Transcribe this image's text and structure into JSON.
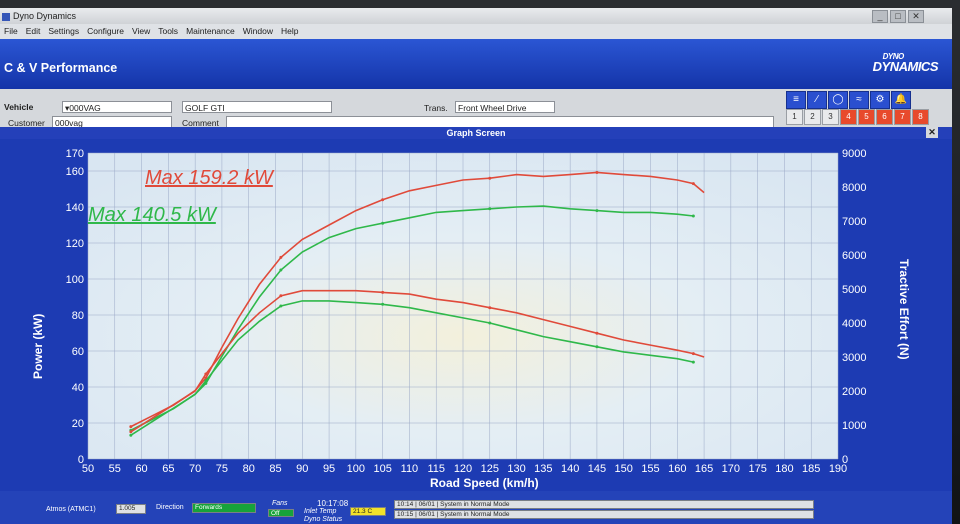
{
  "window": {
    "title": "Dyno Dynamics",
    "buttons": [
      "_",
      "□",
      "✕"
    ]
  },
  "menu": [
    "File",
    "Edit",
    "Settings",
    "Configure",
    "View",
    "Tools",
    "Maintenance",
    "Window",
    "Help"
  ],
  "header": {
    "app_name": "C & V Performance",
    "logo_top": "DYNO",
    "logo_main": "DYNAMICS"
  },
  "info": {
    "vehicle_label": "Vehicle",
    "vehicle_value": "000VAG",
    "model_value": "GOLF GTI",
    "trans_label": "Trans.",
    "trans_value": "Front Wheel Drive",
    "customer_label": "Customer",
    "customer_value": "000vag",
    "comment_label": "Comment",
    "comment_value": ""
  },
  "toolbar": {
    "icons": [
      "list-icon",
      "line-icon",
      "zoom-icon",
      "chart-icon",
      "engine-icon",
      "bell-icon"
    ],
    "icon_glyphs": [
      "≡",
      "∕",
      "◯",
      "≈",
      "⚙",
      "🔔"
    ],
    "numbers": [
      "1",
      "2",
      "3",
      "4",
      "5",
      "6",
      "7",
      "8"
    ]
  },
  "graph_title": "Graph Screen",
  "chart_data": {
    "type": "line",
    "xlabel": "Road Speed (km/h)",
    "ylabel": "Power (kW)",
    "y2label": "Tractive Effort (N)",
    "xlim": [
      50,
      190
    ],
    "ylim": [
      0,
      170
    ],
    "y2lim": [
      0,
      9000
    ],
    "x_ticks": [
      50,
      55,
      60,
      65,
      70,
      75,
      80,
      85,
      90,
      95,
      100,
      105,
      110,
      115,
      120,
      125,
      130,
      135,
      140,
      145,
      150,
      155,
      160,
      165,
      170,
      175,
      180,
      185,
      190
    ],
    "y_ticks": [
      0,
      20,
      40,
      60,
      80,
      100,
      120,
      140,
      160,
      170
    ],
    "y2_ticks": [
      0,
      1000,
      2000,
      3000,
      4000,
      5000,
      6000,
      7000,
      8000,
      9000
    ],
    "annotations": [
      "Max 159.2 kW",
      "Max 140.5 kW"
    ],
    "series": [
      {
        "color": "#e04a3a",
        "axis": "power",
        "x": [
          58,
          62,
          66,
          70,
          72,
          75,
          78,
          82,
          86,
          90,
          95,
          100,
          105,
          110,
          115,
          120,
          125,
          130,
          135,
          140,
          145,
          150,
          155,
          160,
          163,
          165
        ],
        "values": [
          18,
          24,
          30,
          38,
          45,
          62,
          78,
          97,
          112,
          122,
          130,
          138,
          144,
          149,
          152,
          155,
          156,
          158,
          157,
          158,
          159.2,
          158,
          157,
          155,
          153,
          148
        ]
      },
      {
        "color": "#2fb84a",
        "axis": "power",
        "x": [
          58,
          62,
          66,
          70,
          72,
          75,
          78,
          82,
          86,
          90,
          95,
          100,
          105,
          110,
          115,
          120,
          125,
          130,
          135,
          140,
          145,
          150,
          155,
          160,
          163
        ],
        "values": [
          16,
          22,
          28,
          36,
          42,
          57,
          72,
          90,
          105,
          115,
          123,
          128,
          131,
          134,
          137,
          138,
          139,
          140,
          140.5,
          139,
          138,
          137,
          137,
          136,
          135
        ]
      },
      {
        "color": "#e04a3a",
        "axis": "tractive",
        "x": [
          58,
          62,
          66,
          70,
          72,
          75,
          78,
          82,
          86,
          90,
          95,
          100,
          105,
          110,
          115,
          120,
          125,
          130,
          135,
          140,
          145,
          150,
          155,
          160,
          163,
          165
        ],
        "values": [
          800,
          1200,
          1600,
          2000,
          2500,
          3100,
          3700,
          4300,
          4800,
          4950,
          4950,
          4950,
          4900,
          4850,
          4700,
          4600,
          4450,
          4300,
          4100,
          3900,
          3700,
          3500,
          3350,
          3200,
          3100,
          3000
        ]
      },
      {
        "color": "#2fb84a",
        "axis": "tractive",
        "x": [
          58,
          62,
          66,
          70,
          72,
          75,
          78,
          82,
          86,
          90,
          95,
          100,
          105,
          110,
          115,
          120,
          125,
          130,
          135,
          140,
          145,
          150,
          155,
          160,
          163
        ],
        "values": [
          700,
          1100,
          1500,
          1900,
          2300,
          2900,
          3500,
          4050,
          4500,
          4650,
          4650,
          4600,
          4550,
          4450,
          4300,
          4150,
          4000,
          3800,
          3600,
          3450,
          3300,
          3150,
          3050,
          2950,
          2850
        ]
      }
    ]
  },
  "status": {
    "atmos_label": "Atmos (ATMC1)",
    "atmos_value": "1.005",
    "direction_label": "Direction",
    "direction_value": "Forwards",
    "fans_label": "Fans",
    "fans_values": [
      "Off",
      "Off"
    ],
    "time": "10:17:08",
    "inlet_label": "Inlet Temp",
    "inlet_value": "21.3 C",
    "dyno_label": "Dyno Status",
    "log": [
      "10:14 | 06/01 | System in Normal Mode",
      "10:15 | 06/01 | System in Normal Mode"
    ]
  },
  "colors": {
    "accent_blue": "#2443b8",
    "power_red": "#e04a3a",
    "power_green": "#2fb84a"
  }
}
